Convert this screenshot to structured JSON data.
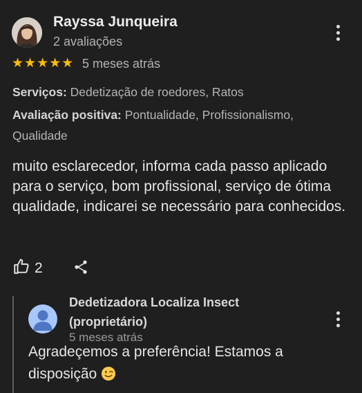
{
  "review": {
    "author_name": "Rayssa Junqueira",
    "author_meta": "2 avaliações",
    "rating": 5,
    "stars_display": "★★★★★",
    "time": "5 meses atrás",
    "services_label": "Serviços:",
    "services_value": " Dedetização de roedores, Ratos",
    "positive_label": "Avaliação positiva:",
    "positive_value": " Pontualidade, Profissionalismo, Qualidade",
    "text": "muito esclarecedor, informa cada passo aplicado para o serviço, bom profissional, serviço de ótima qualidade, indicarei se necessário para conhecidos.",
    "like_count": "2"
  },
  "owner_reply": {
    "owner_name": "Dedetizadora Localiza Insect (proprietário)",
    "time": "5 meses atrás",
    "text": "Agradeçemos a preferência! Estamos a disposição"
  },
  "icons": {
    "more": "more-vert-icon",
    "like": "thumbs-up-icon",
    "share": "share-icon",
    "emoji": "winking-face-emoji",
    "owner_avatar": "default-person-icon"
  },
  "colors": {
    "background": "#1f1f1f",
    "star": "#fbbc04",
    "owner_avatar_bg": "#a8c7fa",
    "emoji_yellow": "#ffcc4d"
  }
}
